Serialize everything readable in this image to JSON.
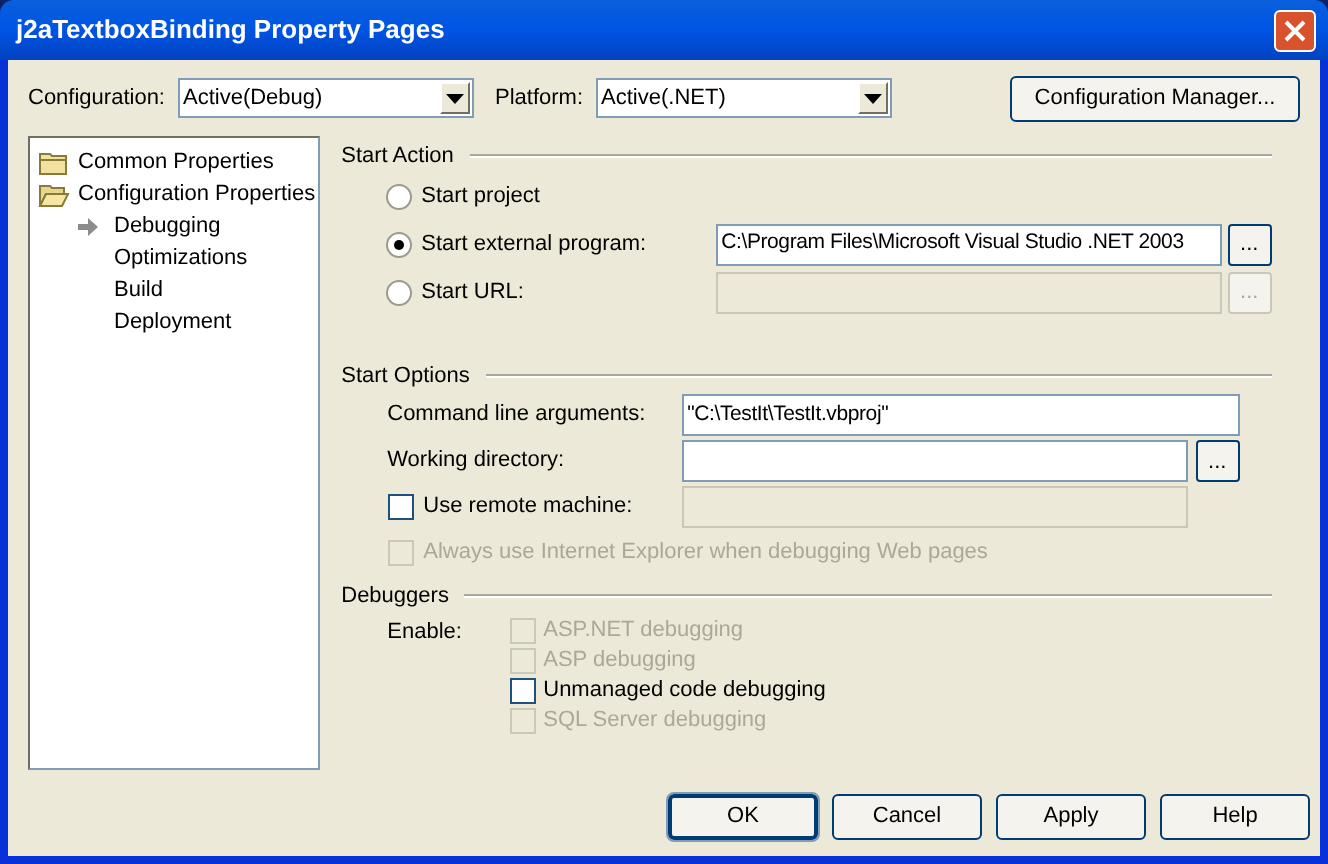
{
  "window": {
    "title": "j2aTextboxBinding Property Pages"
  },
  "toolbar": {
    "configuration": {
      "label": "Configuration:",
      "value": "Active(Debug)"
    },
    "platform": {
      "label": "Platform:",
      "value": "Active(.NET)"
    },
    "manager_button": "Configuration Manager..."
  },
  "tree": [
    {
      "label": "Common Properties",
      "expanded": false,
      "selected": false
    },
    {
      "label": "Configuration Properties",
      "expanded": true,
      "selected": false,
      "children": [
        {
          "label": "Debugging",
          "selected": true
        },
        {
          "label": "Optimizations",
          "selected": false
        },
        {
          "label": "Build",
          "selected": false
        },
        {
          "label": "Deployment",
          "selected": false
        }
      ]
    }
  ],
  "start_action": {
    "title": "Start Action",
    "options": [
      {
        "kind": "plain",
        "label": "Start project",
        "selected": false
      },
      {
        "kind": "field",
        "label": "Start external program:",
        "selected": true,
        "value": "C:\\Program Files\\Microsoft Visual Studio .NET 2003",
        "disabled": false,
        "browse": "..."
      },
      {
        "kind": "field",
        "label": "Start URL:",
        "selected": false,
        "disabled": true,
        "browse": "..."
      }
    ]
  },
  "start_options": {
    "title": "Start Options",
    "rows": [
      {
        "kind": "field",
        "label": "Command line arguments:",
        "value": "\"C:\\TestIt\\TestIt.vbproj\"",
        "disabled": false
      },
      {
        "kind": "field",
        "label": "Working directory:",
        "disabled": false,
        "browse": "..."
      },
      {
        "kind": "checkfield",
        "label": "Use remote machine:",
        "checked": false,
        "disabled": false,
        "field_disabled": true
      },
      {
        "kind": "check",
        "label": "Always use Internet Explorer when debugging Web pages",
        "checked": false,
        "disabled": true
      }
    ]
  },
  "debuggers": {
    "title": "Debuggers",
    "enable_label": "Enable:",
    "options": [
      {
        "label": "ASP.NET debugging",
        "checked": false,
        "disabled": true
      },
      {
        "label": "ASP debugging",
        "checked": false,
        "disabled": true
      },
      {
        "label": "Unmanaged code debugging",
        "checked": false,
        "disabled": false
      },
      {
        "label": "SQL Server debugging",
        "checked": false,
        "disabled": true
      }
    ]
  },
  "buttons": [
    {
      "label": "OK",
      "default": true
    },
    {
      "label": "Cancel",
      "default": false
    },
    {
      "label": "Apply",
      "default": false
    },
    {
      "label": "Help",
      "default": false
    }
  ]
}
